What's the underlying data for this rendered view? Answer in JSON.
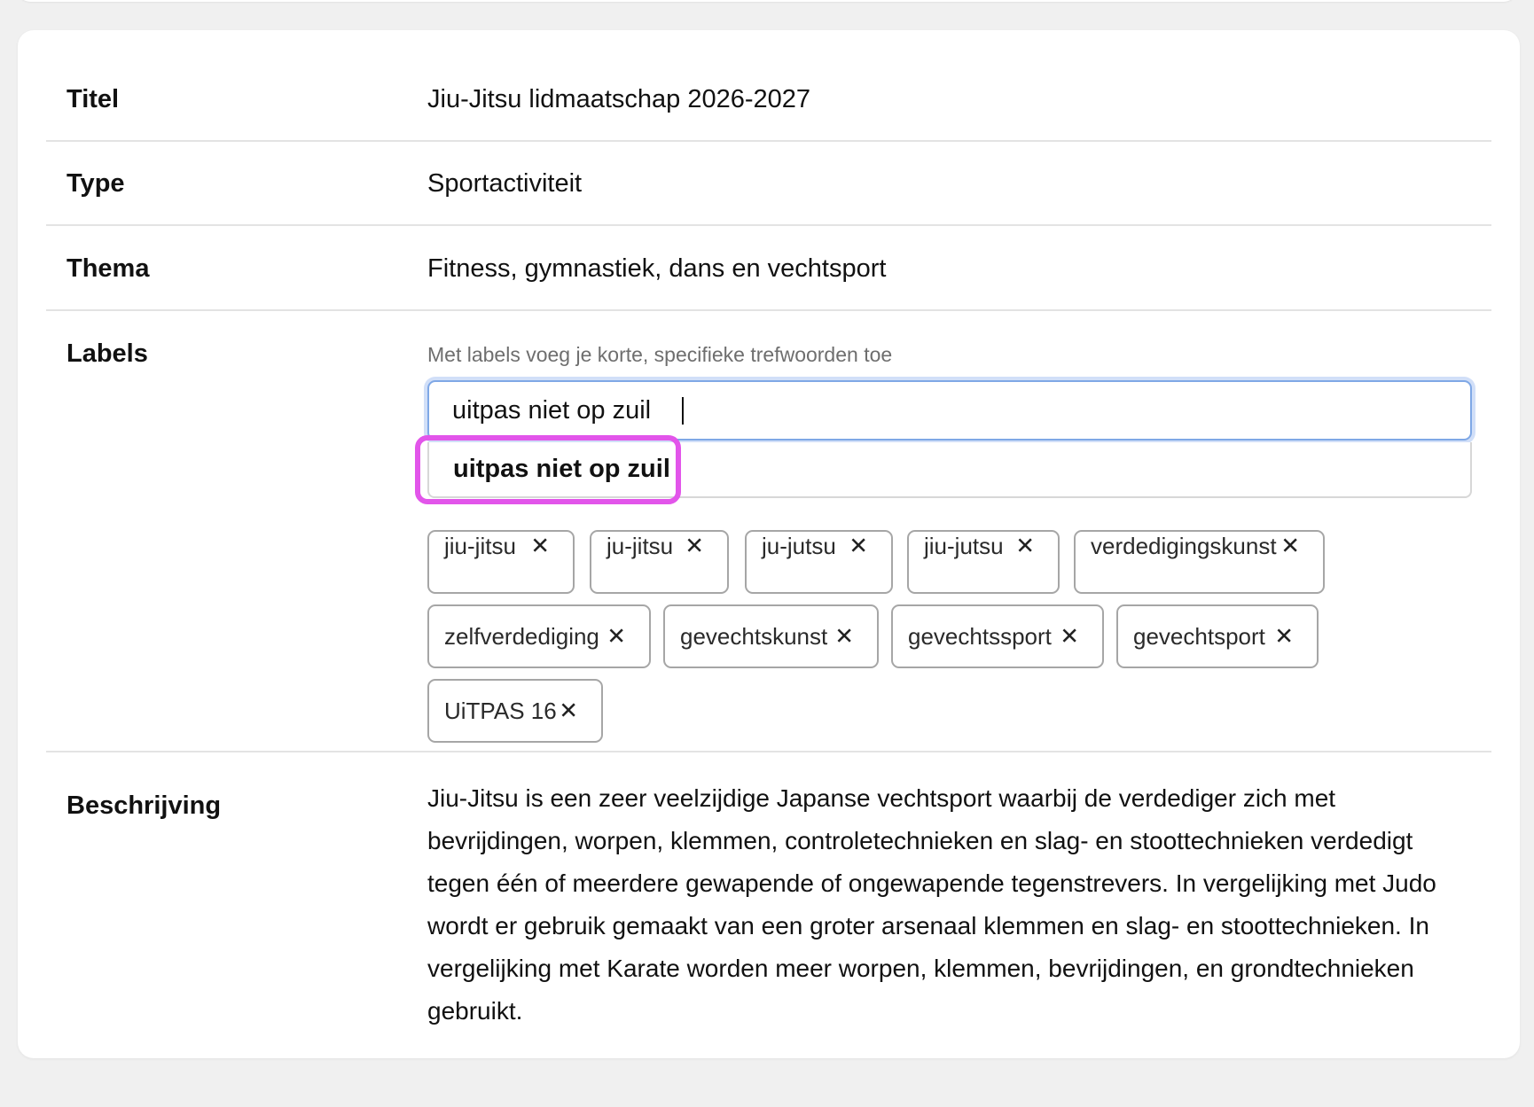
{
  "fields": {
    "title_label": "Titel",
    "title_value": "Jiu-Jitsu lidmaatschap 2026-2027",
    "type_label": "Type",
    "type_value": "Sportactiviteit",
    "theme_label": "Thema",
    "theme_value": "Fitness, gymnastiek, dans en vechtsport",
    "labels_label": "Labels",
    "labels_hint": "Met labels voeg je korte, specifieke trefwoorden toe",
    "description_label": "Beschrijving",
    "description_value": "Jiu-Jitsu is een zeer veelzijdige Japanse vechtsport waarbij de verdediger zich met bevrijdingen, worpen, klemmen, controletechnieken en slag- en stoottechnieken verdedigt tegen één of meerdere gewapende of ongewapende tegenstrevers. In vergelijking met Judo wordt er gebruik gemaakt van een groter arsenaal klemmen en slag- en stoottechnieken. In vergelijking met Karate worden meer worpen, klemmen, bevrijdingen, en grondtechnieken gebruikt."
  },
  "label_input": {
    "value": "uitpas niet op zuil",
    "suggestion": "uitpas niet op zuil"
  },
  "tags": [
    {
      "text": "jiu-jitsu",
      "remove": "✕"
    },
    {
      "text": "ju-jitsu",
      "remove": "✕"
    },
    {
      "text": "ju-jutsu",
      "remove": "✕"
    },
    {
      "text": "jiu-jutsu",
      "remove": "✕"
    },
    {
      "text": "verdedigingskunst",
      "remove": "✕"
    },
    {
      "text": "zelfverdediging",
      "remove": "✕"
    },
    {
      "text": "gevechtskunst",
      "remove": "✕"
    },
    {
      "text": "gevechtssport",
      "remove": "✕"
    },
    {
      "text": "gevechtsport",
      "remove": "✕"
    },
    {
      "text": "UiTPAS 16",
      "remove": "✕"
    }
  ],
  "colors": {
    "focus_ring": "#7fa8e6",
    "highlight": "#e255ea",
    "tag_border": "#a6a6a6"
  }
}
